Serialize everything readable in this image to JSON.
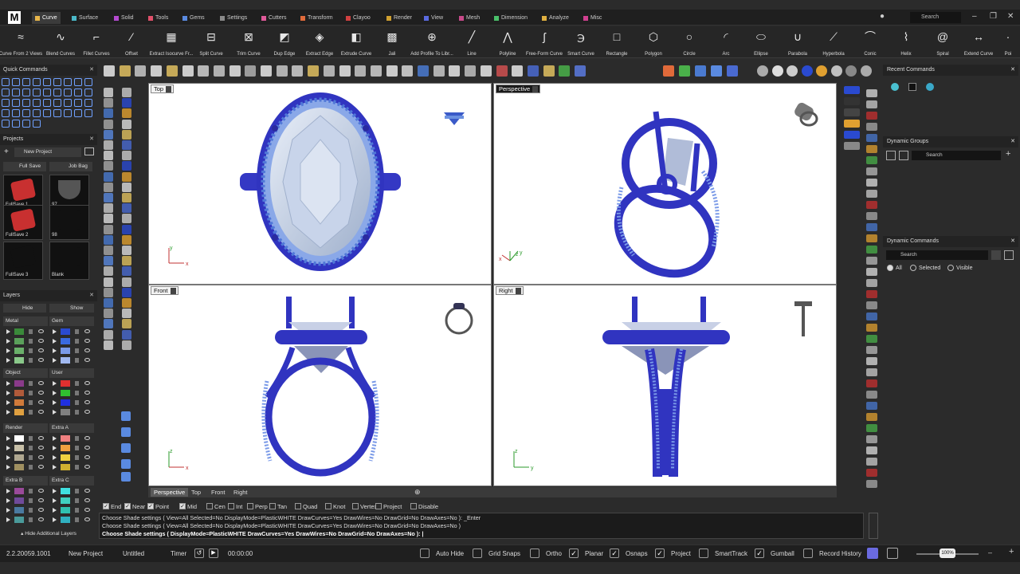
{
  "app": {
    "logo": "M"
  },
  "tabs": [
    {
      "label": "Curve",
      "color": "#e8b64a",
      "active": true
    },
    {
      "label": "Surface",
      "color": "#4ab8c8"
    },
    {
      "label": "Solid",
      "color": "#b44ad0"
    },
    {
      "label": "Tools",
      "color": "#e0506a"
    },
    {
      "label": "Gems",
      "color": "#5a8ae0"
    },
    {
      "label": "Settings",
      "color": "#8a8a8a"
    },
    {
      "label": "Cutters",
      "color": "#e05a9a"
    },
    {
      "label": "Transform",
      "color": "#e06a3a"
    },
    {
      "label": "Clayoo",
      "color": "#d04040"
    },
    {
      "label": "Render",
      "color": "#d0a030"
    },
    {
      "label": "View",
      "color": "#5a6ae0"
    },
    {
      "label": "Mesh",
      "color": "#c84a8a"
    },
    {
      "label": "Dimension",
      "color": "#4ac06a"
    },
    {
      "label": "Analyze",
      "color": "#e0b040"
    },
    {
      "label": "Misc",
      "color": "#d04090"
    }
  ],
  "search_top": "Search",
  "ribbon": [
    {
      "label": "Curve From 2 Views",
      "icon": "≈"
    },
    {
      "label": "Blend Curves",
      "icon": "∿"
    },
    {
      "label": "Fillet Curves",
      "icon": "⌐"
    },
    {
      "label": "Offset",
      "icon": "⁄"
    },
    {
      "label": "Extract Isocurve Fr...",
      "icon": "▦"
    },
    {
      "label": "Split Curve",
      "icon": "⊟"
    },
    {
      "label": "Trim Curve",
      "icon": "⊠"
    },
    {
      "label": "Dup Edge",
      "icon": "◩"
    },
    {
      "label": "Extract Edge",
      "icon": "◈"
    },
    {
      "label": "Extrude Curve",
      "icon": "◧"
    },
    {
      "label": "Jali",
      "icon": "▩"
    },
    {
      "label": "Add Profile To Libr...",
      "icon": "⊕"
    },
    {
      "label": "Line",
      "icon": "╱"
    },
    {
      "label": "Polyline",
      "icon": "⋀"
    },
    {
      "label": "Free-Form Curve",
      "icon": "ʃ"
    },
    {
      "label": "Smart Curve",
      "icon": "℈"
    },
    {
      "label": "Rectangle",
      "icon": "□"
    },
    {
      "label": "Polygon",
      "icon": "⬡"
    },
    {
      "label": "Circle",
      "icon": "○"
    },
    {
      "label": "Arc",
      "icon": "◜"
    },
    {
      "label": "Ellipse",
      "icon": "⬭"
    },
    {
      "label": "Parabola",
      "icon": "∪"
    },
    {
      "label": "Hyperbola",
      "icon": "⟋"
    },
    {
      "label": "Conic",
      "icon": "⌒"
    },
    {
      "label": "Helix",
      "icon": "⌇"
    },
    {
      "label": "Spiral",
      "icon": "@"
    },
    {
      "label": "Extend Curve",
      "icon": "↔"
    },
    {
      "label": "Poi",
      "icon": "·"
    }
  ],
  "left": {
    "quick_commands": "Quick Commands",
    "projects": "Projects",
    "project_select": "New Project",
    "full_save": "Full Save",
    "job_bag": "Job Bag",
    "thumbs": [
      "FullSave 1",
      "97",
      "FullSave 2",
      "98",
      "FullSave 3",
      "Blank"
    ],
    "layers": "Layers",
    "hide": "Hide",
    "show": "Show",
    "hide_additional": "Hide Additional Layers",
    "groups": [
      {
        "name": "Metal",
        "colors": [
          "#3a8a3a",
          "#5aa05a",
          "#6ab06a",
          "#8ac88a"
        ]
      },
      {
        "name": "Gem",
        "colors": [
          "#2a4ad0",
          "#3a6ae0",
          "#7a9ae8",
          "#a0b8f0"
        ]
      },
      {
        "name": "Object",
        "colors": [
          "#8a3a8a",
          "#b05a3a",
          "#d07a3a",
          "#e0a040"
        ]
      },
      {
        "name": "User",
        "colors": [
          "#e03030",
          "#30c030",
          "#2030e0",
          "#808080"
        ]
      },
      {
        "name": "Render",
        "colors": [
          "#ffffff",
          "#c8c0a8",
          "#b0a890",
          "#a09060"
        ]
      },
      {
        "name": "Extra A",
        "colors": [
          "#f08080",
          "#f0a040",
          "#f0d040",
          "#d0b030"
        ]
      },
      {
        "name": "Extra B",
        "colors": [
          "#9a4a9a",
          "#704a9a",
          "#4a7aa0",
          "#4a9a9a"
        ]
      },
      {
        "name": "Extra C",
        "colors": [
          "#40e0e0",
          "#40d0c0",
          "#30c0b0",
          "#30b0c0"
        ]
      }
    ]
  },
  "viewports": [
    {
      "title": "Top",
      "axes": [
        "y",
        "x"
      ]
    },
    {
      "title": "Perspective",
      "axes": [
        "z",
        "y",
        "x"
      ]
    },
    {
      "title": "Front",
      "axes": [
        "z",
        "x"
      ]
    },
    {
      "title": "Right",
      "axes": [
        "z",
        "y"
      ]
    }
  ],
  "viewport_tabs": [
    "Perspective",
    "Top",
    "Front",
    "Right"
  ],
  "right": {
    "recent": "Recent Commands",
    "dyn_groups": "Dynamic Groups",
    "search": "Search",
    "dyn_commands": "Dynamic Commands",
    "radio": [
      "All",
      "Selected",
      "Visible"
    ]
  },
  "osnaps": [
    {
      "label": "End",
      "on": true
    },
    {
      "label": "Near",
      "on": true
    },
    {
      "label": "Point",
      "on": true
    },
    {
      "label": "Mid",
      "on": true
    },
    {
      "label": "Cen",
      "on": false
    },
    {
      "label": "Int",
      "on": false
    },
    {
      "label": "Perp",
      "on": false
    },
    {
      "label": "Tan",
      "on": false
    },
    {
      "label": "Quad",
      "on": false
    },
    {
      "label": "Knot",
      "on": false
    },
    {
      "label": "Vertex",
      "on": false
    },
    {
      "label": "Project",
      "on": false
    },
    {
      "label": "Disable",
      "on": false
    }
  ],
  "command": {
    "line1": "Choose Shade settings ( View=All  Selected=No  DisplayMode=PlasticWHITE  DrawCurves=Yes  DrawWires=No  DrawGrid=No  DrawAxes=No ): _Enter",
    "line2": "Choose Shade settings ( View=All  Selected=No  DisplayMode=PlasticWHITE  DrawCurves=Yes  DrawWires=No  DrawGrid=No  DrawAxes=No )",
    "line3": "Choose Shade settings ( DisplayMode=PlasticWHITE  DrawCurves=Yes  DrawWires=No  DrawGrid=No  DrawAxes=No ): |"
  },
  "status": {
    "version": "2.2.20059.1001",
    "project": "New Project",
    "file": "Untitled",
    "timer": "Timer",
    "time": "00:00:00",
    "toggles": [
      {
        "label": "Auto Hide",
        "on": false
      },
      {
        "label": "Grid Snaps",
        "on": false
      },
      {
        "label": "Ortho",
        "on": false
      },
      {
        "label": "Planar",
        "on": true
      },
      {
        "label": "Osnaps",
        "on": true
      },
      {
        "label": "Project",
        "on": true
      },
      {
        "label": "SmartTrack",
        "on": false
      },
      {
        "label": "Gumball",
        "on": true
      },
      {
        "label": "Record History",
        "on": false
      }
    ],
    "zoom": "100%"
  }
}
